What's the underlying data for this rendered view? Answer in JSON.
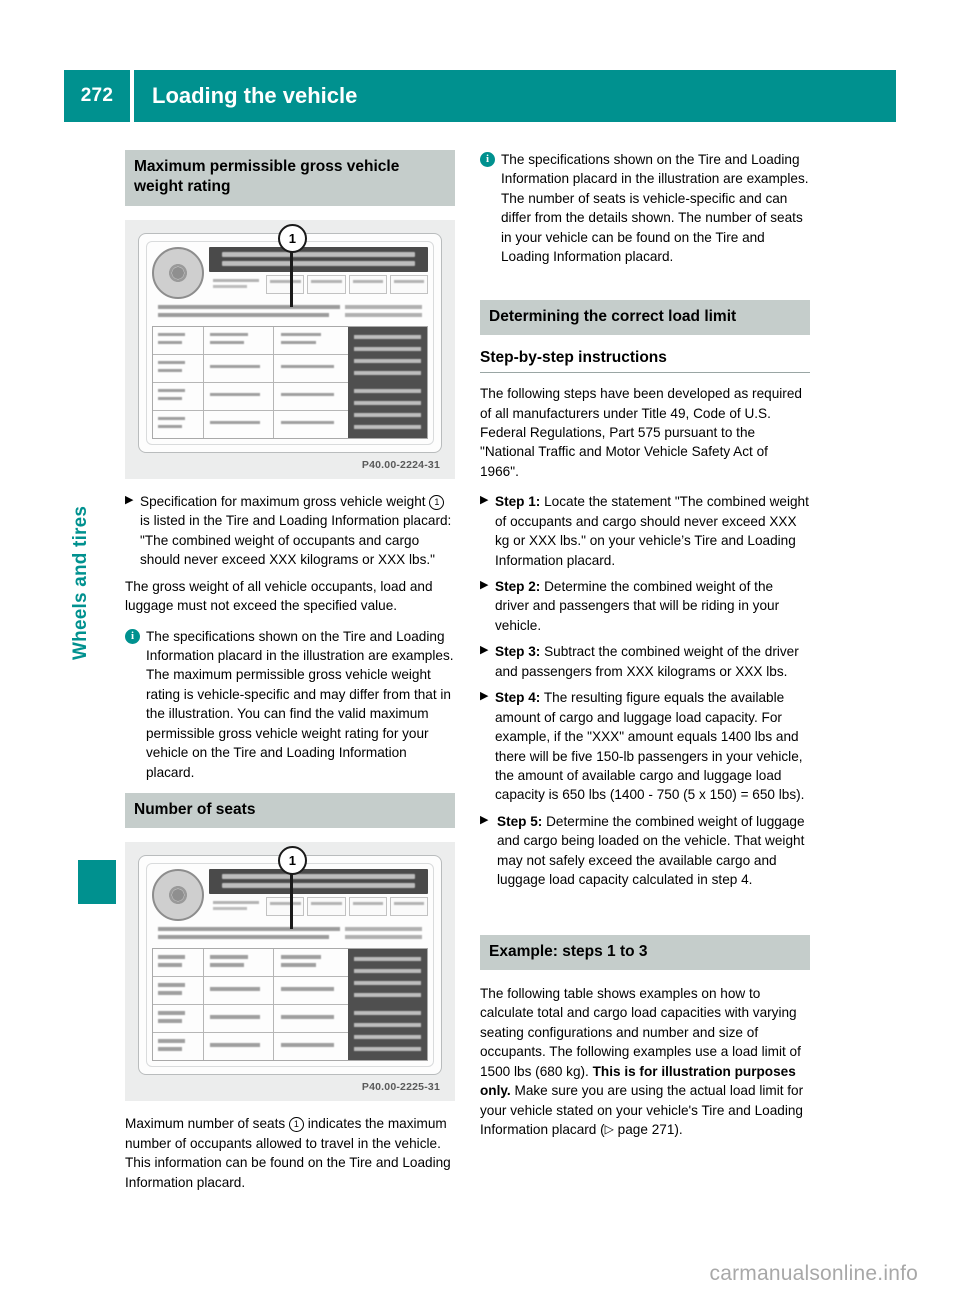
{
  "header": {
    "page_number": "272",
    "title": "Loading the vehicle",
    "accent_color": "#00918f"
  },
  "side_tab": {
    "label": "Wheels and tires"
  },
  "left_column": {
    "heading_1": "Maximum permissible gross vehicle weight rating",
    "figure_1_caption": "P40.00-2224-31",
    "figure_1_callout": "1",
    "bullet_1": {
      "text_a": "Specification for maximum gross vehicle weight ",
      "callout": "1",
      "text_b": " is listed in the Tire and Loading Information placard: \"The combined weight of occupants and cargo should never exceed XXX kilograms or XXX lbs.\""
    },
    "paragraph_1": "The gross weight of all vehicle occupants, load and luggage must not exceed the specified value.",
    "note_1": "The specifications shown on the Tire and Loading Information placard in the illustration are examples. The maximum permissible gross vehicle weight rating is vehicle-specific and may differ from that in the illustration. You can find the valid maximum permissible gross vehicle weight rating for your vehicle on the Tire and Loading Information placard.",
    "heading_2": "Number of seats",
    "figure_2_caption": "P40.00-2225-31",
    "figure_2_callout": "1",
    "paragraph_2": {
      "text_a": "Maximum number of seats ",
      "callout": "1",
      "text_b": " indicates the maximum number of occupants allowed to travel in the vehicle. This information can be found on the Tire and Loading Information placard."
    }
  },
  "right_column": {
    "note_1": "The specifications shown on the Tire and Loading Information placard in the illustration are examples. The number of seats is vehicle-specific and can differ from the details shown. The number of seats in your vehicle can be found on the Tire and Loading Information placard.",
    "heading_1": "Determining the correct load limit",
    "subheading_1": "Step-by-step instructions",
    "paragraph_1": "The following steps have been developed as required of all manufacturers under Title 49, Code of U.S. Federal Regulations, Part 575 pursuant to the \"National Traffic and Motor Vehicle Safety Act of 1966\".",
    "steps": [
      {
        "label": "Step 1:",
        "text": " Locate the statement \"The combined weight of occupants and cargo should never exceed XXX kg or XXX lbs.\" on your vehicle’s Tire and Loading Information placard."
      },
      {
        "label": "Step 2:",
        "text": " Determine the combined weight of the driver and passengers that will be riding in your vehicle."
      },
      {
        "label": "Step 3:",
        "text": " Subtract the combined weight of the driver and passengers from XXX kilograms or XXX lbs."
      },
      {
        "label": "Step 4:",
        "text": " The resulting figure equals the available amount of cargo and luggage load capacity. For example, if the \"XXX\" amount equals 1400 lbs and there will be five 150-lb passengers in your vehicle, the amount of available cargo and luggage load capacity is 650 lbs (1400 - 750 (5 x 150) = 650 lbs)."
      },
      {
        "label": "Step 5:",
        "text": " Determine the combined weight of luggage and cargo being loaded on the vehicle. That weight may not safely exceed the available cargo and luggage load capacity calculated in step 4."
      }
    ],
    "heading_2": "Example: steps 1 to 3",
    "paragraph_2": {
      "text_a": "The following table shows examples on how to calculate total and cargo load capacities with varying seating configurations and number and size of occupants. The following examples use a load limit of 1500 lbs (680 kg). ",
      "bold": "This is for illustration purposes only.",
      "text_b": " Make sure you are using the actual load limit for your vehicle stated on your vehicle's Tire and Loading Information placard (",
      "xref_symbol": "▷",
      "xref": " page 271",
      "text_c": ")."
    }
  },
  "footer": {
    "watermark": "carmanualsonline.info"
  }
}
